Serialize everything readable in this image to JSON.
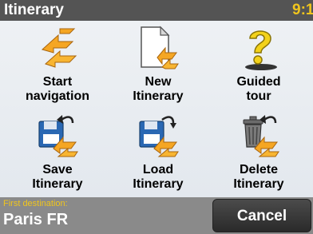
{
  "header": {
    "title": "Itinerary",
    "clock": "9:1"
  },
  "menu": {
    "items": [
      {
        "label_line1": "Start",
        "label_line2": "navigation",
        "icon": "start-navigation-arrows-icon"
      },
      {
        "label_line1": "New",
        "label_line2": "Itinerary",
        "icon": "new-document-icon"
      },
      {
        "label_line1": "Guided",
        "label_line2": "tour",
        "icon": "question-mark-icon"
      },
      {
        "label_line1": "Save",
        "label_line2": "Itinerary",
        "icon": "save-disk-icon"
      },
      {
        "label_line1": "Load",
        "label_line2": "Itinerary",
        "icon": "load-disk-icon"
      },
      {
        "label_line1": "Delete",
        "label_line2": "Itinerary",
        "icon": "trash-can-icon"
      }
    ]
  },
  "footer": {
    "destination_title": "First destination:",
    "destination_value": "Paris FR",
    "cancel_label": "Cancel"
  },
  "colors": {
    "accent": "#f0c51d",
    "title_bar": "#545454",
    "footer_bar": "#8a8a8a",
    "icon_orange": "#f5a623",
    "icon_blue": "#2a68b3"
  }
}
